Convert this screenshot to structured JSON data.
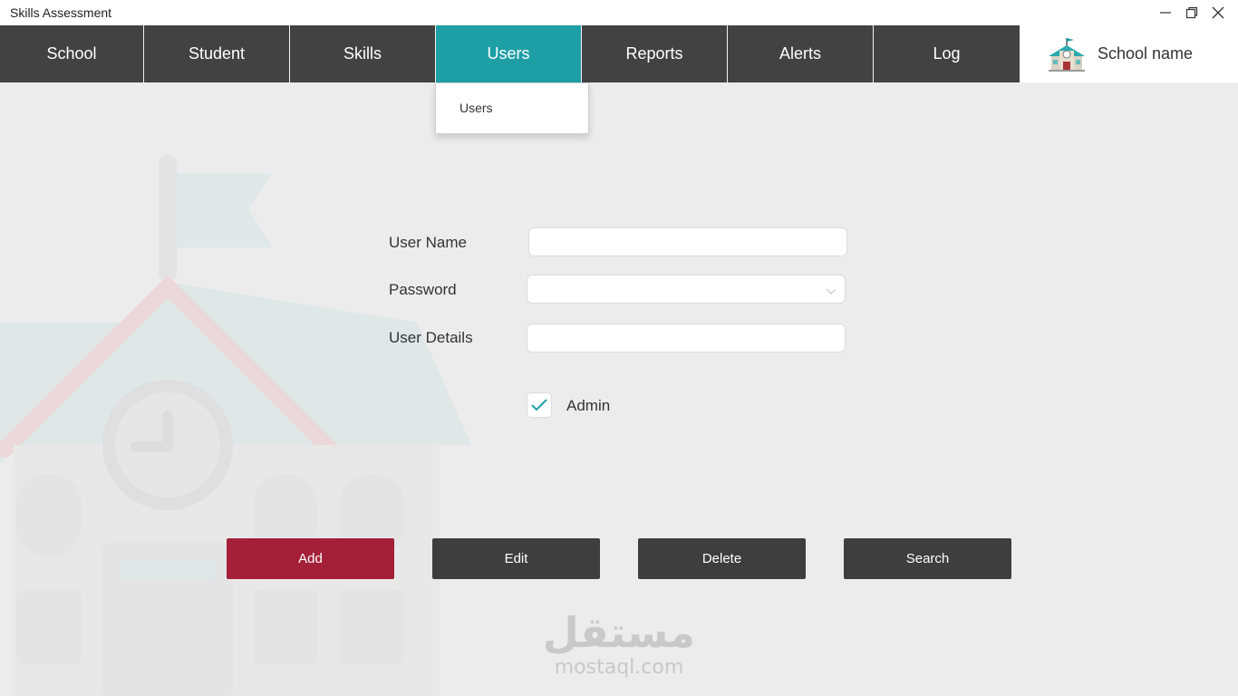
{
  "window": {
    "title": "Skills Assessment"
  },
  "nav": {
    "items": [
      {
        "label": "School"
      },
      {
        "label": "Student"
      },
      {
        "label": "Skills"
      },
      {
        "label": "Users",
        "active": true
      },
      {
        "label": "Reports"
      },
      {
        "label": "Alerts"
      },
      {
        "label": "Log"
      }
    ],
    "brand_name": "School name",
    "active_color": "#1e9fa6",
    "bar_color": "#424242"
  },
  "dropdown": {
    "items": [
      {
        "label": "Users"
      }
    ]
  },
  "form": {
    "user_name_label": "User Name",
    "user_name_value": "",
    "password_label": "Password",
    "password_value": "",
    "user_details_label": "User Details",
    "user_details_value": "",
    "admin_label": "Admin",
    "admin_checked": true
  },
  "actions": {
    "add": "Add",
    "edit": "Edit",
    "delete": "Delete",
    "search": "Search",
    "add_color": "#a32038"
  },
  "watermark": {
    "arabic": "مستقل",
    "latin": "mostaql.com"
  }
}
